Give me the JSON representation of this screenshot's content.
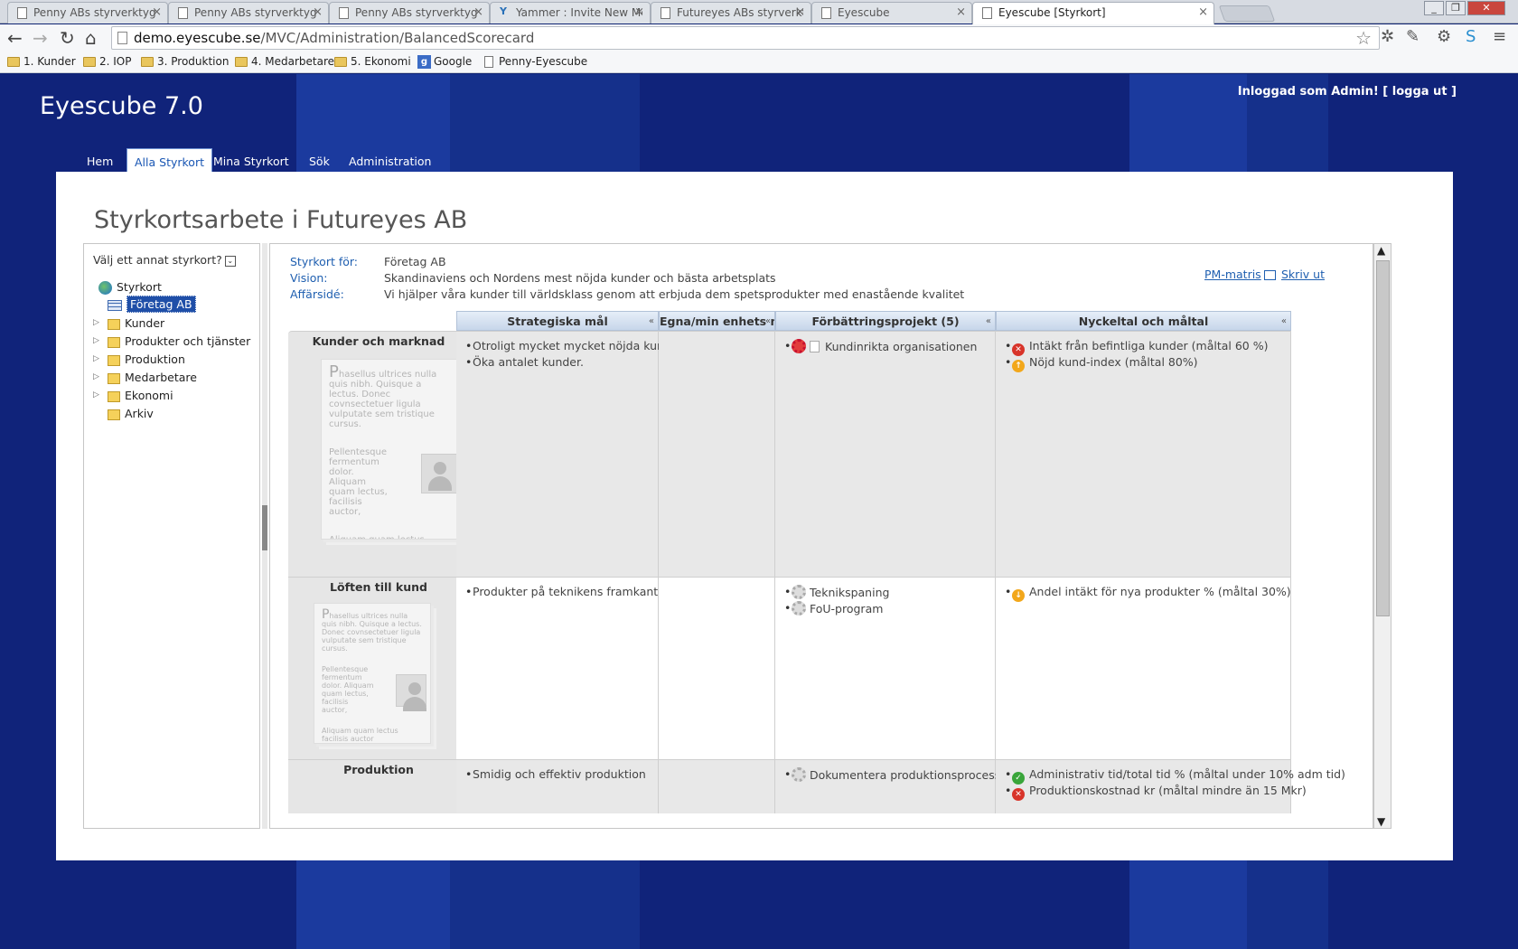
{
  "browser": {
    "tabs": [
      {
        "title": "Penny ABs styrverktyg - Sta",
        "icon": "page-icon"
      },
      {
        "title": "Penny ABs styrverktyg - Ak",
        "icon": "page-icon"
      },
      {
        "title": "Penny ABs styrverktyg",
        "icon": "page-icon"
      },
      {
        "title": "Yammer : Invite New Mem",
        "icon": "yammer-icon"
      },
      {
        "title": "Futureyes ABs styrverktyg -",
        "icon": "page-icon"
      },
      {
        "title": "Eyescube",
        "icon": "page-icon"
      },
      {
        "title": "Eyescube [Styrkort]",
        "icon": "page-icon",
        "active": true
      }
    ],
    "url_domain": "demo.eyescube.se",
    "url_path": "/MVC/Administration/BalancedScorecard",
    "bookmarks": [
      {
        "label": "1. Kunder",
        "icon": "folder-icon"
      },
      {
        "label": "2. IOP",
        "icon": "folder-icon"
      },
      {
        "label": "3. Produktion",
        "icon": "folder-icon"
      },
      {
        "label": "4. Medarbetare",
        "icon": "folder-icon"
      },
      {
        "label": "5. Ekonomi",
        "icon": "folder-icon"
      },
      {
        "label": "Google",
        "icon": "google-icon"
      },
      {
        "label": "Penny-Eyescube",
        "icon": "page-icon"
      }
    ]
  },
  "site": {
    "brand": "Eyescube 7.0",
    "login_text": "Inloggad som Admin!",
    "logout_text": "[ logga ut ]",
    "nav": [
      "Hem",
      "Alla Styrkort",
      "Mina Styrkort",
      "Sök",
      "Administration"
    ],
    "active_nav": "Alla Styrkort",
    "page_title": "Styrkortsarbete i Futureyes AB"
  },
  "tree": {
    "chooser_label": "Välj ett annat styrkort?",
    "root": "Styrkort",
    "selected": "Företag AB",
    "children": [
      "Kunder",
      "Produkter och tjänster",
      "Produktion",
      "Medarbetare",
      "Ekonomi",
      "Arkiv"
    ]
  },
  "scorecard": {
    "meta": [
      {
        "key": "Styrkort för:",
        "value": "Företag AB"
      },
      {
        "key": "Vision:",
        "value": "Skandinaviens och Nordens mest nöjda kunder och bästa arbetsplats"
      },
      {
        "key": "Affärsidé:",
        "value": "Vi hjälper våra kunder till världsklass genom att erbjuda dem spetsprodukter med enastående kvalitet"
      }
    ],
    "links": {
      "pm_matris": "PM-matris",
      "print": "Skriv ut"
    },
    "columns": [
      "Strategiska mål",
      "Egna/min enhets mål",
      "Förbättringsprojekt (5)",
      "Nyckeltal och måltal"
    ],
    "placeholder_text": {
      "p1": "hasellus ultrices nulla quis nibh. Quisque a lectus. Donec covnsectetuer ligula vulputate sem tristique cursus.",
      "p2": "Pellentesque fermentum dolor. Aliquam quam lectus, facilisis auctor,",
      "p3": "Aliquam quam lectus facilisis auctor"
    },
    "rows": [
      {
        "perspective": "Kunder och marknad",
        "goals": [
          "Otroligt mycket mycket nöjda kunder",
          "Öka antalet kunder."
        ],
        "projects": [
          {
            "label": "Kundinrikta organisationen",
            "status": "active"
          }
        ],
        "kpis": [
          {
            "label": "Intäkt från befintliga kunder (måltal 60 %)",
            "status": "red"
          },
          {
            "label": "Nöjd kund-index (måltal 80%)",
            "status": "up"
          }
        ]
      },
      {
        "perspective": "Löften till kund",
        "goals": [
          "Produkter på teknikens framkant"
        ],
        "projects": [
          {
            "label": "Teknikspaning",
            "status": "idle"
          },
          {
            "label": "FoU-program",
            "status": "idle"
          }
        ],
        "kpis": [
          {
            "label": "Andel intäkt för nya produkter % (måltal 30%)",
            "status": "down"
          }
        ]
      },
      {
        "perspective": "Produktion",
        "goals": [
          "Smidig och effektiv produktion"
        ],
        "projects": [
          {
            "label": "Dokumentera produktionsprocesserna",
            "status": "idle"
          }
        ],
        "kpis": [
          {
            "label": "Administrativ tid/total tid % (måltal under 10% adm tid)",
            "status": "green"
          },
          {
            "label": "Produktionskostnad kr (måltal mindre än 15 Mkr)",
            "status": "red"
          }
        ]
      }
    ]
  },
  "colors": {
    "site_bg": "#10237a",
    "link": "#1f5fb0",
    "header_grad": "#c7d6ea"
  }
}
